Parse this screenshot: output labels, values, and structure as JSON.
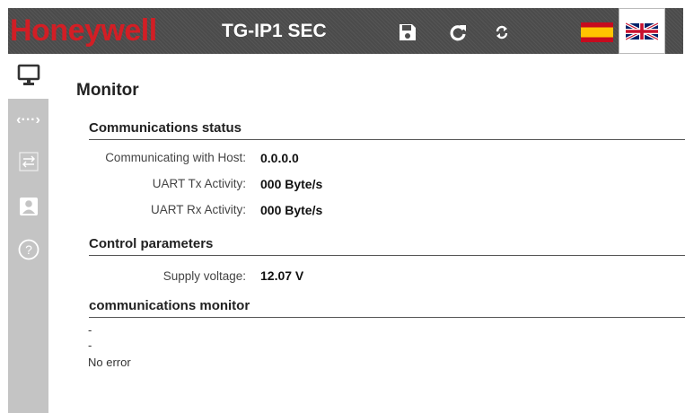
{
  "header": {
    "brand": "Honeywell",
    "product": "TG-IP1 SEC",
    "buttons": [
      {
        "icon": "save-icon"
      },
      {
        "icon": "refresh-icon"
      },
      {
        "icon": "sync-icon"
      }
    ],
    "languages": [
      {
        "icon": "spain-flag-icon"
      },
      {
        "icon": "uk-flag-icon",
        "selected": true
      }
    ]
  },
  "sidebar": {
    "items": [
      {
        "icon": "monitor-icon",
        "active": true
      },
      {
        "icon": "code-icon"
      },
      {
        "icon": "transfer-icon"
      },
      {
        "icon": "user-icon"
      },
      {
        "icon": "help-icon"
      }
    ]
  },
  "main": {
    "title": "Monitor",
    "comm_status": {
      "heading": "Communications status",
      "rows": [
        {
          "label": "Communicating with Host:",
          "value": "0.0.0.0"
        },
        {
          "label": "UART Tx Activity:",
          "value": "000 Byte/s"
        },
        {
          "label": "UART Rx Activity:",
          "value": "000 Byte/s"
        }
      ]
    },
    "control": {
      "heading": "Control parameters",
      "rows": [
        {
          "label": "Supply voltage:",
          "value": "12.07 V"
        }
      ]
    },
    "monitor": {
      "heading": "communications monitor",
      "lines": [
        "-",
        "-",
        "No error"
      ]
    }
  },
  "colors": {
    "brand_red": "#d21e25",
    "topbar": "#4e4e4e",
    "sidebar": "#c4c4c4"
  }
}
